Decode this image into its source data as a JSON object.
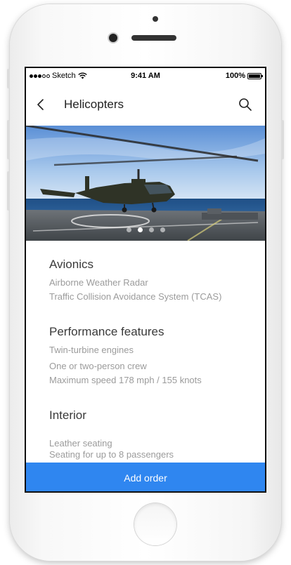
{
  "status_bar": {
    "carrier": "Sketch",
    "time": "9:41 AM",
    "battery": "100%"
  },
  "nav": {
    "title": "Helicopters",
    "back_icon": "chevron-left-icon",
    "search_icon": "search-icon"
  },
  "carousel": {
    "image": "helicopter-on-ship-deck",
    "page_count": 4,
    "active_index": 1
  },
  "sections": [
    {
      "title": "Avionics",
      "items": [
        "Airborne Weather Radar",
        "Traffic Collision Avoidance System (TCAS)"
      ]
    },
    {
      "title": "Performance features",
      "items": [
        "Twin-turbine engines",
        "One or two-person crew",
        "Maximum speed 178 mph / 155 knots"
      ]
    },
    {
      "title": "Interior",
      "items": [
        "Leather seating",
        "Seating for up to 8 passengers"
      ]
    }
  ],
  "cta": {
    "label": "Add order"
  },
  "colors": {
    "accent": "#2f86f0",
    "heading": "#3a3a3a",
    "muted": "#9b9b9b"
  }
}
